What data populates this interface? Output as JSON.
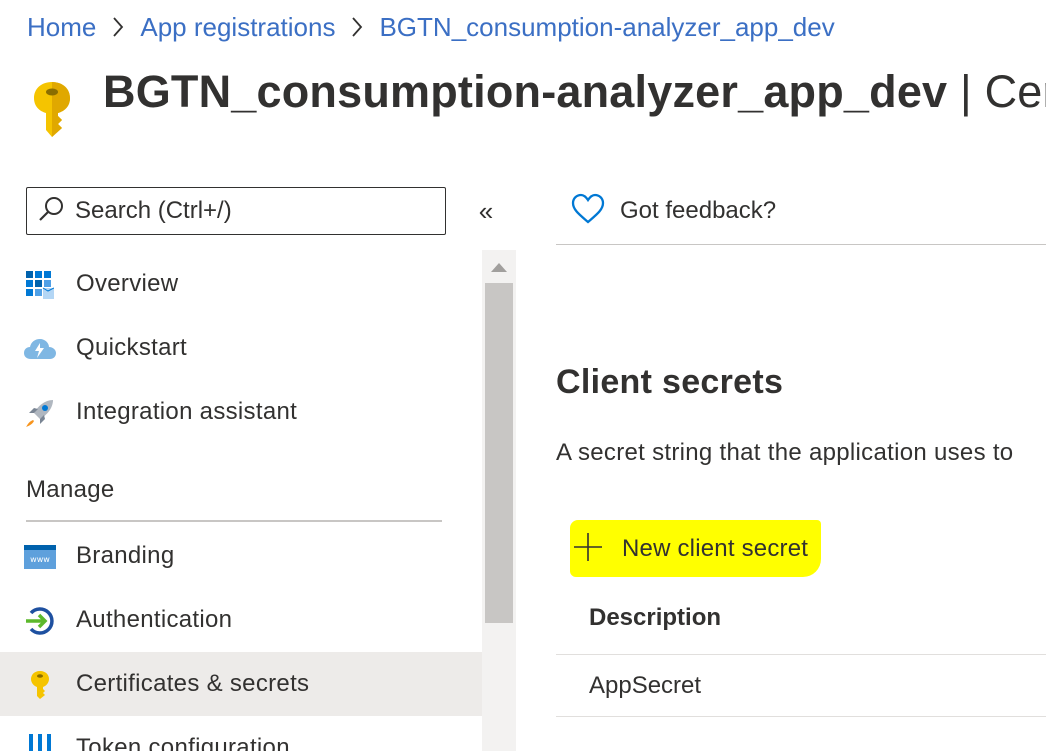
{
  "breadcrumb": {
    "items": [
      "Home",
      "App registrations",
      "BGTN_consumption-analyzer_app_dev"
    ]
  },
  "header": {
    "title": "BGTN_consumption-analyzer_app_dev",
    "title_suffix": "| Cert",
    "icon": "key-icon"
  },
  "sidebar": {
    "search_placeholder": "Search (Ctrl+/)",
    "collapse_label": "«",
    "items": [
      {
        "label": "Overview",
        "icon": "overview-grid-icon"
      },
      {
        "label": "Quickstart",
        "icon": "quickstart-cloud-icon"
      },
      {
        "label": "Integration assistant",
        "icon": "rocket-icon"
      }
    ],
    "manage_header": "Manage",
    "manage_items": [
      {
        "label": "Branding",
        "icon": "branding-icon"
      },
      {
        "label": "Authentication",
        "icon": "authentication-icon"
      },
      {
        "label": "Certificates & secrets",
        "icon": "key-icon",
        "selected": true
      },
      {
        "label": "Token configuration",
        "icon": "token-bars-icon"
      }
    ]
  },
  "toolbar": {
    "feedback_label": "Got feedback?"
  },
  "main": {
    "section_title": "Client secrets",
    "section_desc": "A secret string that the application uses to",
    "new_secret_label": "New client secret",
    "table": {
      "columns": [
        "Description"
      ],
      "rows": [
        [
          "AppSecret"
        ]
      ]
    }
  },
  "colors": {
    "link": "#3b6fc4",
    "highlight": "#ffff00",
    "selected_bg": "#edebe9",
    "key_gold": "#f5c400"
  }
}
